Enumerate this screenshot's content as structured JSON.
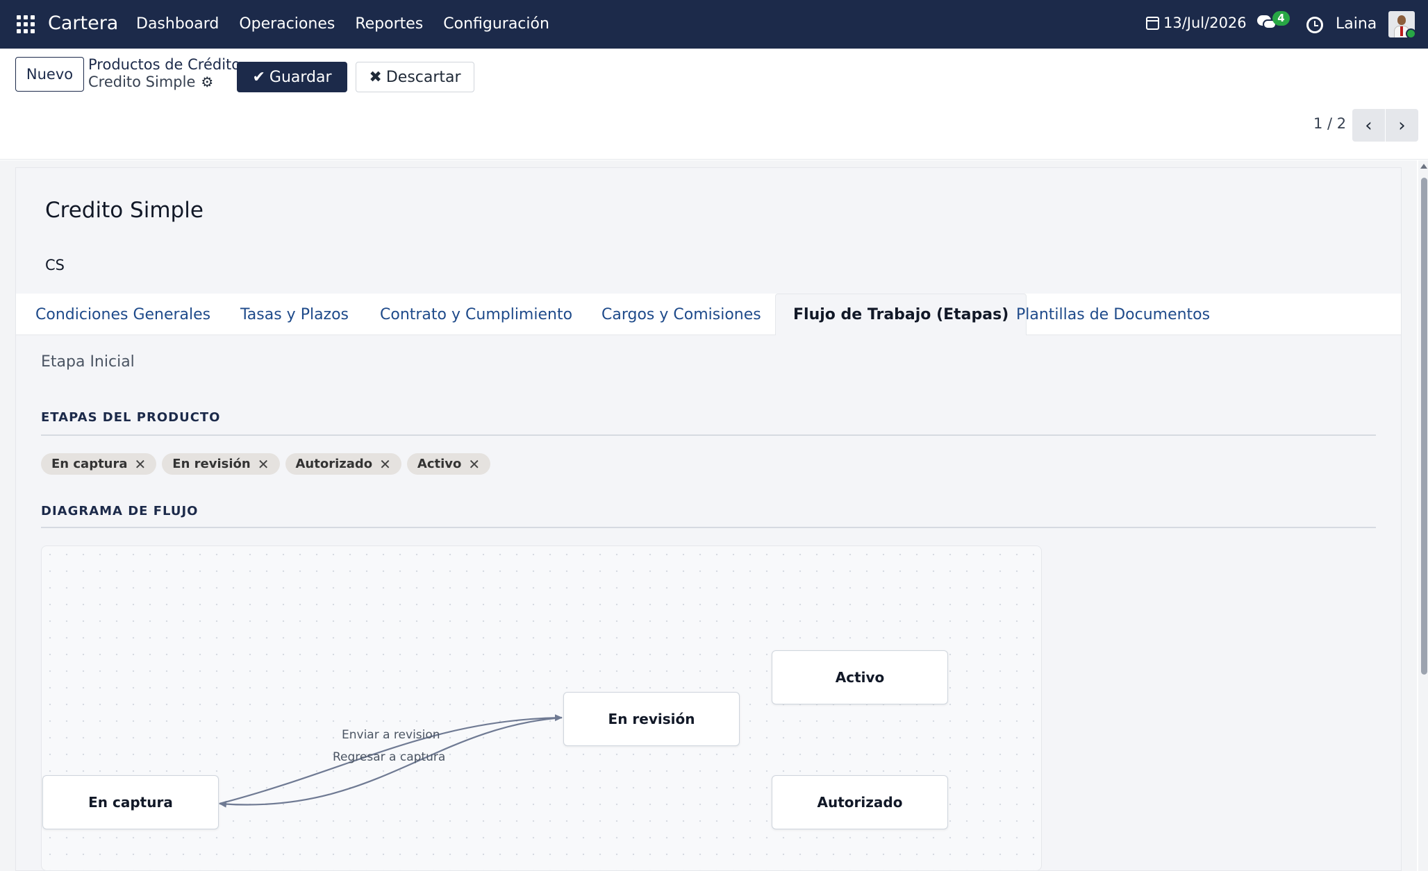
{
  "navbar": {
    "brand": "Cartera",
    "menu": [
      "Dashboard",
      "Operaciones",
      "Reportes",
      "Configuración"
    ],
    "date": "13/Jul/2026",
    "messages_count": "4",
    "user": "Laina"
  },
  "control_panel": {
    "new_label": "Nuevo",
    "breadcrumb_parent": "Productos de Crédito",
    "breadcrumb_current": "Credito Simple",
    "save_label": "Guardar",
    "discard_label": "Descartar",
    "pager": "1 / 2"
  },
  "record": {
    "name": "Credito Simple",
    "code": "CS"
  },
  "tabs": [
    {
      "label": "Condiciones Generales"
    },
    {
      "label": "Tasas y Plazos"
    },
    {
      "label": "Contrato y Cumplimiento"
    },
    {
      "label": "Cargos y Comisiones"
    },
    {
      "label": "Flujo de Trabajo (Etapas)",
      "active": true
    },
    {
      "label": "Plantillas de Documentos"
    }
  ],
  "workflow": {
    "initial_stage_label": "Etapa Inicial",
    "stages_title": "ETAPAS DEL PRODUCTO",
    "stages": [
      {
        "label": "En captura"
      },
      {
        "label": "En revisión"
      },
      {
        "label": "Autorizado"
      },
      {
        "label": "Activo"
      }
    ],
    "diagram_title": "DIAGRAMA DE FLUJO",
    "edges": [
      {
        "label": "Enviar a revision",
        "from": "En captura",
        "to": "En revisión"
      },
      {
        "label": "Regresar a captura",
        "from": "En revisión",
        "to": "En captura"
      }
    ]
  },
  "colors": {
    "navbar": "#1c2a4a",
    "accent": "#1c2a4a",
    "link": "#1e4a8a",
    "badge": "#28a745",
    "edge": "#6f7a93"
  }
}
